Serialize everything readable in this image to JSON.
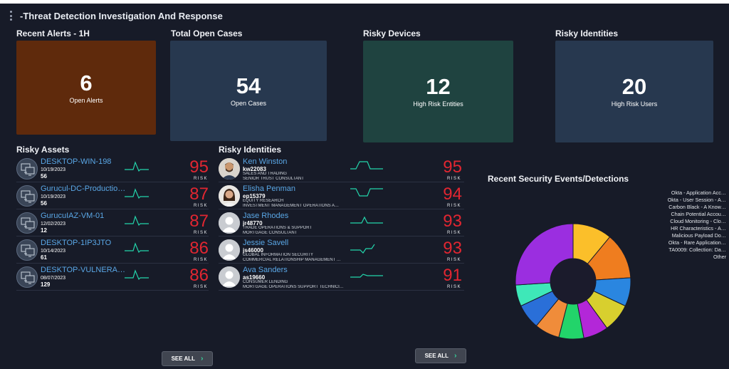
{
  "page": {
    "title": "-Threat Detection Investigation And Response"
  },
  "cards": [
    {
      "title": "Recent Alerts - 1H",
      "value": "6",
      "label": "Open Alerts",
      "color": "#5f2a0c"
    },
    {
      "title": "Total Open Cases",
      "value": "54",
      "label": "Open Cases",
      "color": "#27384f"
    },
    {
      "title": "Risky Devices",
      "value": "12",
      "label": "High Risk Entities",
      "color": "#1f4340"
    },
    {
      "title": "Risky Identities",
      "value": "20",
      "label": "High Risk Users",
      "color": "#27384f"
    }
  ],
  "risky_assets": {
    "title": "Risky Assets",
    "risk_label": "RISK",
    "see_all": "SEE ALL",
    "items": [
      {
        "name": "DESKTOP-WIN-198",
        "date": "10/19/2023",
        "count": "56",
        "score": "95",
        "icon": "computer-network-icon"
      },
      {
        "name": "Gurucul-DC-Productio…",
        "date": "10/19/2023",
        "count": "56",
        "score": "87",
        "icon": "computer-network-icon"
      },
      {
        "name": "GurucuIAZ-VM-01",
        "date": "12/02/2023",
        "count": "12",
        "score": "87",
        "icon": "computer-network-icon"
      },
      {
        "name": "DESKTOP-1IP3JTO",
        "date": "10/14/2023",
        "count": "61",
        "score": "86",
        "icon": "computer-network-icon"
      },
      {
        "name": "DESKTOP-VULNERAB…",
        "date": "08/07/2023",
        "count": "129",
        "score": "86",
        "icon": "computer-network-icon"
      }
    ]
  },
  "risky_identities": {
    "title": "Risky Identities",
    "risk_label": "RISK",
    "see_all": "SEE ALL",
    "items": [
      {
        "name": "Ken Winston",
        "id": "kw22083",
        "dept": "SALES AND TRADING",
        "role": "SENIOR TRUST CONSULTANT",
        "score": "95",
        "photo": "man-photo"
      },
      {
        "name": "Elisha Penman",
        "id": "ep15379",
        "dept": "EQUITY RESEARCH",
        "role": "INVESTMENT MANAGEMENT OPERATIONS A…",
        "score": "94",
        "photo": "woman-photo"
      },
      {
        "name": "Jase Rhodes",
        "id": "jr48770",
        "dept": "TRADE OPERATIONS & SUPPORT",
        "role": "MORTGAGE CONSULTANT",
        "score": "93",
        "photo": "default-user"
      },
      {
        "name": "Jessie Savell",
        "id": "js46000",
        "dept": "GLOBAL INFORMATION SECURITY",
        "role": "COMMERCIAL RELATIONSHIP MANAGEMENT …",
        "score": "93",
        "photo": "default-user"
      },
      {
        "name": "Ava Sanders",
        "id": "as19660",
        "dept": "CONSUMER LENDING",
        "role": "MORTGAGE OPERATIONS SUPPORT TECHNICI…",
        "score": "91",
        "photo": "default-user"
      }
    ]
  },
  "events": {
    "title": "Recent Security Events/Detections",
    "legend": [
      "Okta - Application Acc…",
      "Okta - User Session - A…",
      "Carbon Black - A Know…",
      "Chain Potential Accou…",
      "Cloud Monitoring - Clo…",
      "HR Characteristics - A…",
      "Malicious Payload Do…",
      "Okta - Rare Application…",
      "TA0009: Collection: Da…",
      "Other"
    ],
    "colors": {
      "accent": "#23d5ab",
      "risk": "#e12631",
      "link": "#5aa7e6"
    }
  },
  "chart_data": {
    "type": "pie",
    "title": "Recent Security Events/Detections",
    "categories": [
      "Okta - Application Acc…",
      "Okta - User Session - A…",
      "Carbon Black - A Know…",
      "Chain Potential Accou…",
      "Cloud Monitoring - Clo…",
      "HR Characteristics - A…",
      "Malicious Payload Do…",
      "Okta - Rare Application…",
      "TA0009: Collection: Da…",
      "Other"
    ],
    "values": [
      11,
      13,
      8,
      8,
      7,
      7,
      7,
      7,
      6,
      26
    ],
    "colors": [
      "#fbbf2a",
      "#ef7d1f",
      "#2a86e0",
      "#d8cf2e",
      "#b327d8",
      "#22d46a",
      "#f08c3a",
      "#2a6fd8",
      "#3ee8b8",
      "#9b2ee0"
    ],
    "legend_position": "right"
  }
}
